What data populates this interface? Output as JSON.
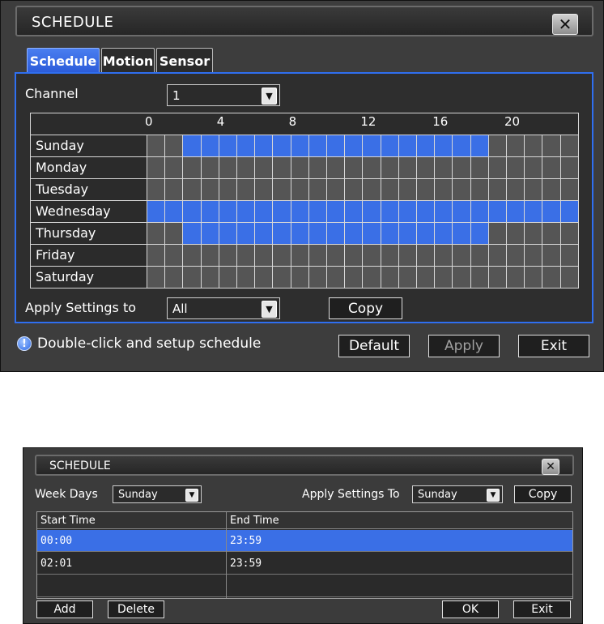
{
  "dialog1": {
    "title": "SCHEDULE",
    "close_glyph": "✕",
    "tabs": [
      {
        "label": "Schedule",
        "active": true
      },
      {
        "label": "Motion",
        "active": false
      },
      {
        "label": "Sensor",
        "active": false
      }
    ],
    "channel_label": "Channel",
    "channel_value": "1",
    "hour_labels": [
      "0",
      "4",
      "8",
      "12",
      "16",
      "20"
    ],
    "days": [
      {
        "name": "Sunday",
        "slots": [
          0,
          0,
          1,
          1,
          1,
          1,
          1,
          1,
          1,
          1,
          1,
          1,
          1,
          1,
          1,
          1,
          1,
          1,
          1,
          0,
          0,
          0,
          0,
          0
        ]
      },
      {
        "name": "Monday",
        "slots": [
          0,
          0,
          0,
          0,
          0,
          0,
          0,
          0,
          0,
          0,
          0,
          0,
          0,
          0,
          0,
          0,
          0,
          0,
          0,
          0,
          0,
          0,
          0,
          0
        ]
      },
      {
        "name": "Tuesday",
        "slots": [
          0,
          0,
          0,
          0,
          0,
          0,
          0,
          0,
          0,
          0,
          0,
          0,
          0,
          0,
          0,
          0,
          0,
          0,
          0,
          0,
          0,
          0,
          0,
          0
        ]
      },
      {
        "name": "Wednesday",
        "slots": [
          1,
          1,
          1,
          1,
          1,
          1,
          1,
          1,
          1,
          1,
          1,
          1,
          1,
          1,
          1,
          1,
          1,
          1,
          1,
          1,
          1,
          1,
          1,
          1
        ]
      },
      {
        "name": "Thursday",
        "slots": [
          0,
          0,
          1,
          1,
          1,
          1,
          1,
          1,
          1,
          1,
          1,
          1,
          1,
          1,
          1,
          1,
          1,
          1,
          1,
          0,
          0,
          0,
          0,
          0
        ]
      },
      {
        "name": "Friday",
        "slots": [
          0,
          0,
          0,
          0,
          0,
          0,
          0,
          0,
          0,
          0,
          0,
          0,
          0,
          0,
          0,
          0,
          0,
          0,
          0,
          0,
          0,
          0,
          0,
          0
        ]
      },
      {
        "name": "Saturday",
        "slots": [
          0,
          0,
          0,
          0,
          0,
          0,
          0,
          0,
          0,
          0,
          0,
          0,
          0,
          0,
          0,
          0,
          0,
          0,
          0,
          0,
          0,
          0,
          0,
          0
        ]
      }
    ],
    "apply_label": "Apply Settings to",
    "apply_value": "All",
    "copy_label": "Copy",
    "hint": "Double-click and setup schedule",
    "hint_icon": "info-bulb-icon",
    "default_label": "Default",
    "apply_button_label": "Apply",
    "exit_label": "Exit",
    "on_color": "#3a6fe6",
    "off_color": "#555555"
  },
  "dialog2": {
    "title": "SCHEDULE",
    "close_glyph": "✕",
    "weekdays_label": "Week Days",
    "weekdays_value": "Sunday",
    "apply_to_label": "Apply Settings To",
    "apply_to_value": "Sunday",
    "copy_label": "Copy",
    "columns": [
      "Start Time",
      "End Time"
    ],
    "rows": [
      {
        "start": "00:00",
        "end": "23:59",
        "selected": true
      },
      {
        "start": "02:01",
        "end": "23:59",
        "selected": false
      },
      {
        "start": "",
        "end": "",
        "selected": false
      }
    ],
    "add_label": "Add",
    "delete_label": "Delete",
    "ok_label": "OK",
    "exit_label": "Exit"
  }
}
